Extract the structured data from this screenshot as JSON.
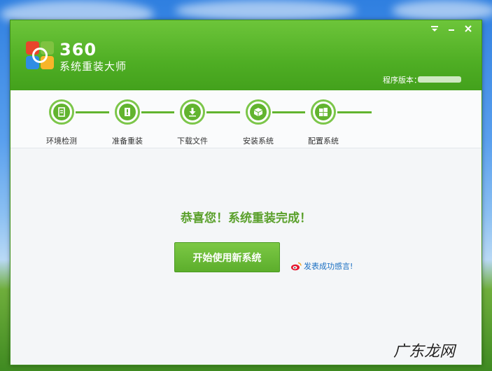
{
  "app": {
    "brand_number": "360",
    "brand_name": "系统重装大师",
    "version_label": "程序版本：",
    "controls": {
      "menu": "menu-icon",
      "minimize": "minimize-icon",
      "close": "close-icon"
    }
  },
  "steps": [
    {
      "label": "环境检测",
      "icon": "document-icon"
    },
    {
      "label": "准备重装",
      "icon": "alert-clipboard-icon"
    },
    {
      "label": "下载文件",
      "icon": "download-icon"
    },
    {
      "label": "安装系统",
      "icon": "package-icon"
    },
    {
      "label": "配置系统",
      "icon": "windows-icon"
    }
  ],
  "main": {
    "congrats": "恭喜您！系统重装完成！",
    "start_button": "开始使用新系统",
    "share_link": "发表成功感言!"
  },
  "watermark": "广东龙网",
  "colors": {
    "brand_green": "#4fae24",
    "accent_green": "#62b42f",
    "link_blue": "#1a6fc2"
  }
}
